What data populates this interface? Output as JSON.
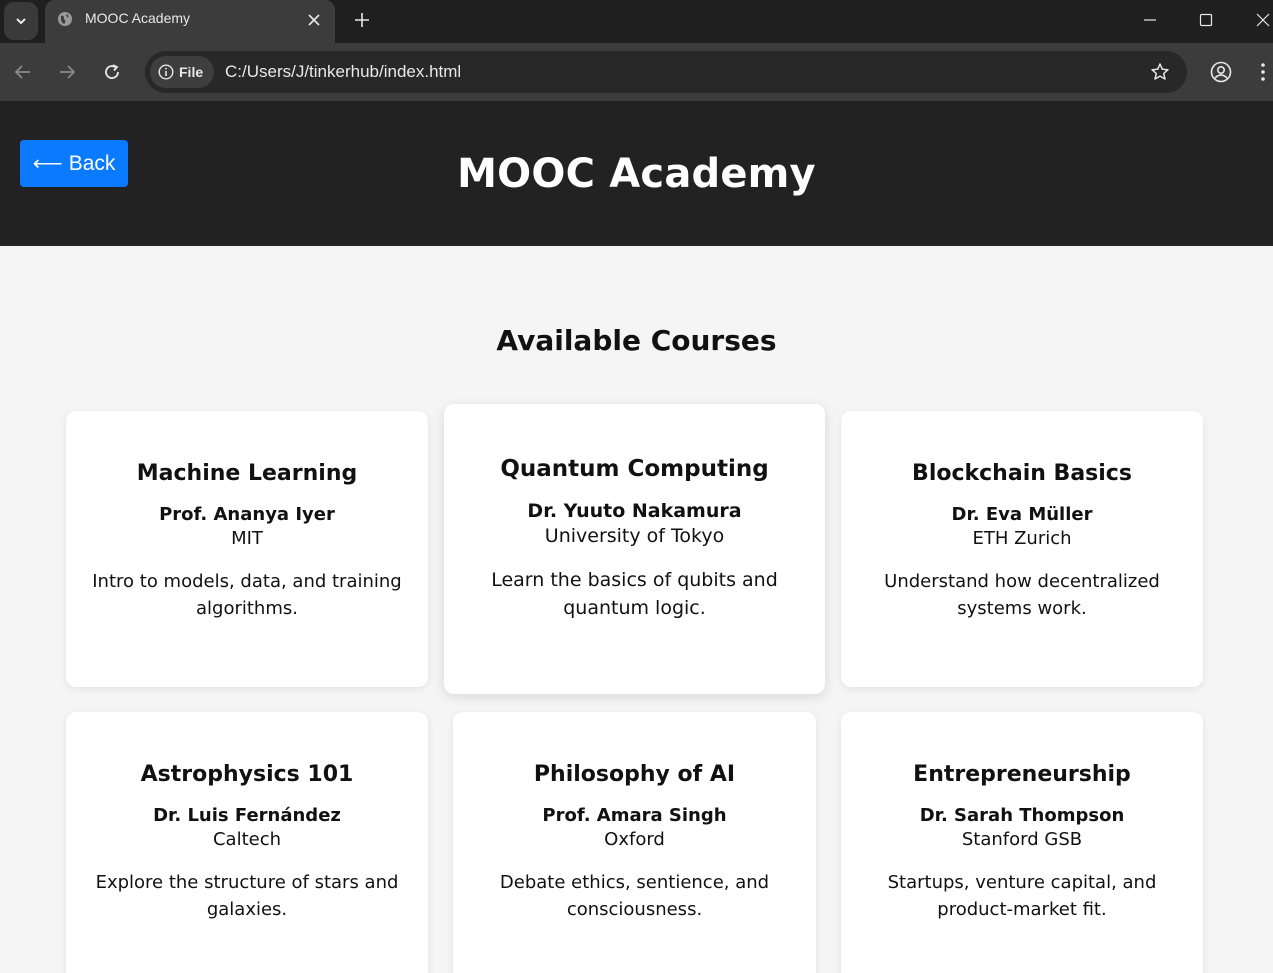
{
  "browser": {
    "tab_title": "MOOC Academy",
    "chip_label": "File",
    "url": "C:/Users/J/tinkerhub/index.html",
    "icons": [
      "chevron-down-icon",
      "globe-icon",
      "close-icon",
      "plus-icon",
      "minimize-icon",
      "maximize-icon",
      "window-close-icon",
      "back-arrow-icon",
      "forward-arrow-icon",
      "reload-icon",
      "info-icon",
      "star-icon",
      "profile-icon",
      "kebab-menu-icon"
    ]
  },
  "header": {
    "back_label": "Back",
    "back_arrow": "⟵",
    "title": "MOOC Academy"
  },
  "main": {
    "section_title": "Available Courses",
    "courses": [
      {
        "title": "Machine Learning",
        "professor": "Prof. Ananya Iyer",
        "institution": "MIT",
        "description": "Intro to models, data, and training algorithms."
      },
      {
        "title": "Quantum Computing",
        "professor": "Dr. Yuuto Nakamura",
        "institution": "University of Tokyo",
        "description": "Learn the basics of qubits and quantum logic."
      },
      {
        "title": "Blockchain Basics",
        "professor": "Dr. Eva Müller",
        "institution": "ETH Zurich",
        "description": "Understand how decentralized systems work."
      },
      {
        "title": "Astrophysics 101",
        "professor": "Dr. Luis Fernández",
        "institution": "Caltech",
        "description": "Explore the structure of stars and galaxies."
      },
      {
        "title": "Philosophy of AI",
        "professor": "Prof. Amara Singh",
        "institution": "Oxford",
        "description": "Debate ethics, sentience, and consciousness."
      },
      {
        "title": "Entrepreneurship",
        "professor": "Dr. Sarah Thompson",
        "institution": "Stanford GSB",
        "description": "Startups, venture capital, and product-market fit."
      }
    ]
  }
}
